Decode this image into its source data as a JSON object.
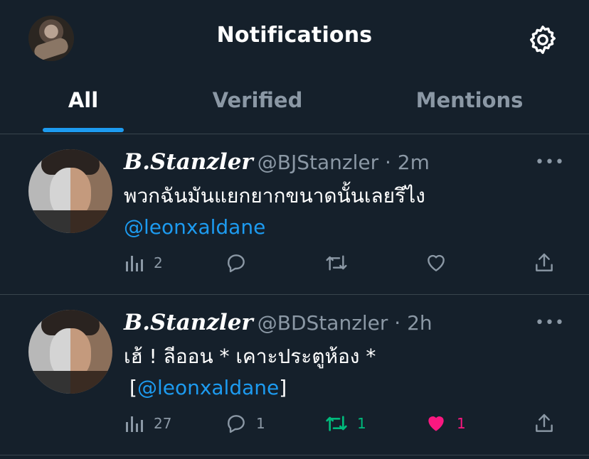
{
  "header": {
    "title": "Notifications",
    "avatar_icon": "profile-avatar",
    "settings_icon": "gear-icon"
  },
  "tabs": [
    {
      "label": "All",
      "active": true
    },
    {
      "label": "Verified",
      "active": false
    },
    {
      "label": "Mentions",
      "active": false
    }
  ],
  "colors": {
    "background": "#15202b",
    "accent": "#1d9bf0",
    "muted": "#8b98a5",
    "retweet_active": "#00ba7c",
    "like_active": "#f91880",
    "divider": "#38444d"
  },
  "tweets": [
    {
      "name": "B.Stanzler",
      "meta": "@BJStanzler · 2m",
      "text": "พวกฉันมันแยกยากขนาดนั้นเลยรึไง",
      "mention": "@leonxaldane",
      "prefix": "",
      "suffix": "",
      "views": "2",
      "replies": "",
      "retweets": "",
      "likes": "",
      "retweeted": false,
      "liked": false
    },
    {
      "name": "B.Stanzler",
      "meta": "@BDStanzler · 2h",
      "text": "เฮ้ ! ลีออน * เคาะประตูห้อง *",
      "mention": "@leonxaldane",
      "prefix": "[",
      "suffix": "]",
      "views": "27",
      "replies": "1",
      "retweets": "1",
      "likes": "1",
      "retweeted": true,
      "liked": true
    }
  ]
}
